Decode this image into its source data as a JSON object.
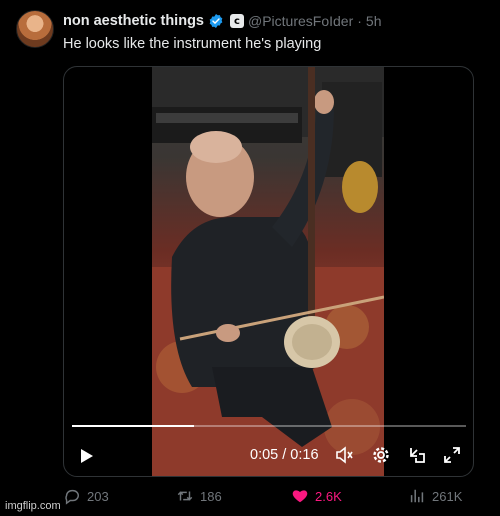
{
  "tweet": {
    "display_name": "non aesthetic things",
    "affiliation_badge": "c",
    "handle": "@PicturesFoIder",
    "separator": "·",
    "time": "5h",
    "text": "He looks like the instrument he's playing"
  },
  "video": {
    "time_readout": "0:05 / 0:16",
    "progress": 0.31
  },
  "actions": {
    "replies": "203",
    "reposts": "186",
    "likes": "2.6K",
    "views": "261K"
  },
  "watermark": "imgflip.com",
  "colors": {
    "background": "#000000",
    "text": "#e7e9ea",
    "muted": "#71767b",
    "verified": "#1d9bf0",
    "like": "#f91880",
    "border": "#2f3336"
  },
  "icons": {
    "verified": "verified-badge-icon",
    "play": "play-icon",
    "mute": "volume-muted-icon",
    "settings": "gear-icon",
    "picture_in_picture": "minimize-icon",
    "fullscreen": "expand-icon",
    "reply": "reply-icon",
    "repost": "repost-icon",
    "like": "heart-icon",
    "views": "views-icon"
  }
}
